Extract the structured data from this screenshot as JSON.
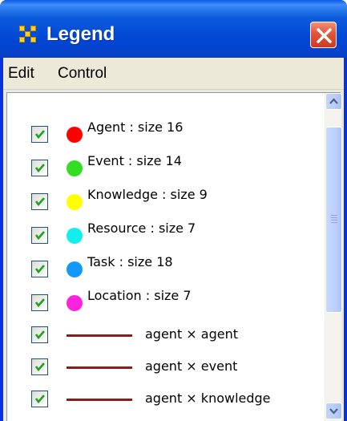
{
  "window": {
    "title": "Legend",
    "app_icon": "network-grid-icon",
    "close_icon": "close-x-icon"
  },
  "menu": {
    "items": [
      {
        "label": "Edit"
      },
      {
        "label": "Control"
      }
    ]
  },
  "legend": {
    "nodes": [
      {
        "label": "Agent : size 16",
        "color": "#ff0000",
        "checked": true
      },
      {
        "label": "Event : size 14",
        "color": "#33dd22",
        "checked": true
      },
      {
        "label": "Knowledge : size 9",
        "color": "#ffff00",
        "checked": true
      },
      {
        "label": "Resource : size 7",
        "color": "#11eeee",
        "checked": true
      },
      {
        "label": "Task : size 18",
        "color": "#1199ff",
        "checked": true
      },
      {
        "label": "Location : size 7",
        "color": "#ff22dd",
        "checked": true
      }
    ],
    "edges": [
      {
        "label": "agent × agent",
        "color": "#8b1c1c",
        "checked": true
      },
      {
        "label": "agent × event",
        "color": "#8b1c1c",
        "checked": true
      },
      {
        "label": "agent × knowledge",
        "color": "#8b1c1c",
        "checked": true
      }
    ]
  },
  "scrollbar": {
    "up_icon": "chevron-up-icon",
    "down_icon": "chevron-down-icon"
  }
}
